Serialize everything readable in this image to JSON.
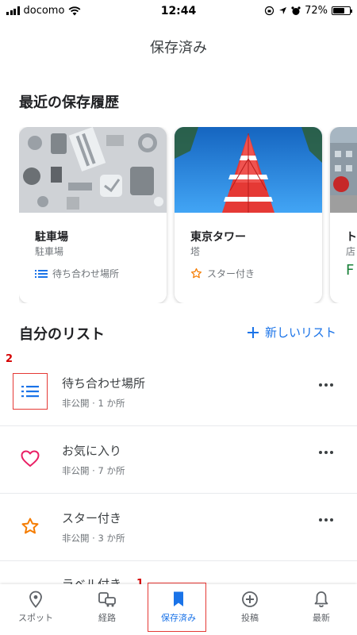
{
  "status_bar": {
    "carrier": "docomo",
    "time": "12:44",
    "battery": "72%",
    "battery_level": 0.72
  },
  "header": {
    "title": "保存済み"
  },
  "recent": {
    "heading": "最近の保存履歴",
    "cards": [
      {
        "title": "駐車場",
        "subtitle": "駐車場",
        "tag": "待ち合わせ場所",
        "tag_icon": "list-icon"
      },
      {
        "title": "東京タワー",
        "subtitle": "塔",
        "tag": "スター付き",
        "tag_icon": "star-icon"
      },
      {
        "title": "ト",
        "subtitle": "店",
        "tag": "F",
        "tag_icon": ""
      }
    ]
  },
  "my_lists": {
    "heading": "自分のリスト",
    "new_list_label": "新しいリスト",
    "items": [
      {
        "name": "待ち合わせ場所",
        "meta": "非公開 · 1 か所",
        "icon": "list-icon",
        "color": "#1a73e8"
      },
      {
        "name": "お気に入り",
        "meta": "非公開 · 7 か所",
        "icon": "heart-icon",
        "color": "#e91e63"
      },
      {
        "name": "スター付き",
        "meta": "非公開 · 3 か所",
        "icon": "star-icon",
        "color": "#f57c00"
      },
      {
        "name": "ラベル付き",
        "meta": "",
        "icon": "",
        "color": ""
      }
    ]
  },
  "annotations": {
    "one": "1",
    "two": "2"
  },
  "bottom_nav": {
    "items": [
      {
        "label": "スポット",
        "icon": "location-pin-icon"
      },
      {
        "label": "経路",
        "icon": "commute-icon"
      },
      {
        "label": "保存済み",
        "icon": "bookmark-icon",
        "active": true
      },
      {
        "label": "投稿",
        "icon": "add-circle-icon"
      },
      {
        "label": "最新",
        "icon": "bell-icon"
      }
    ]
  },
  "colors": {
    "accent": "#1a73e8",
    "annotation": "#d50000"
  }
}
